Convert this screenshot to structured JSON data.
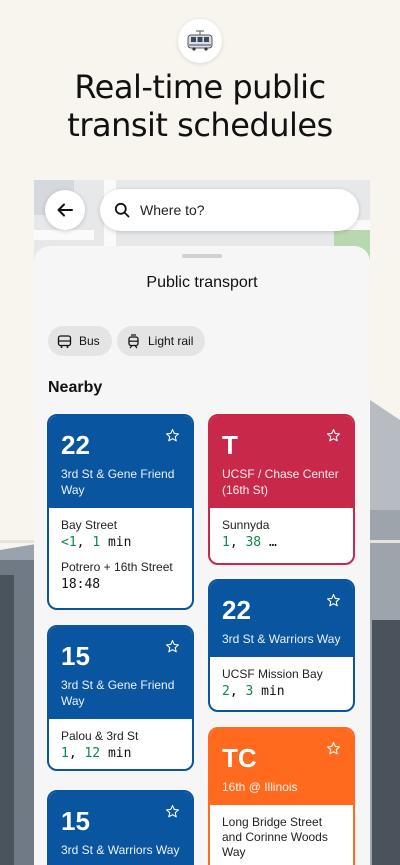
{
  "promo": {
    "headline_line1": "Real-time public",
    "headline_line2": "transit schedules",
    "icon": "tram-icon"
  },
  "search": {
    "placeholder": "Where to?"
  },
  "sheet": {
    "title": "Public transport",
    "filters": [
      {
        "label": "Bus",
        "icon": "bus-icon"
      },
      {
        "label": "Light rail",
        "icon": "light-rail-icon"
      }
    ],
    "section_title": "Nearby"
  },
  "cards": {
    "c1": {
      "route": "22",
      "stop": "3rd St & Gene Friend Way",
      "color": "#0a55a0",
      "arrivals": [
        {
          "dest": "Bay Street",
          "time_a": "<1",
          "sep": ", ",
          "time_b": "1",
          "unit": " min"
        },
        {
          "dest": "Potrero + 16th Street",
          "clock": "18:48"
        }
      ]
    },
    "c2": {
      "route": "15",
      "stop": "3rd St & Gene Friend Way",
      "color": "#0a55a0",
      "arrivals": [
        {
          "dest": "Palou & 3rd St",
          "time_a": "1",
          "sep": ", ",
          "time_b": "12",
          "unit": " min"
        }
      ]
    },
    "c3": {
      "route": "15",
      "stop": "3rd St & Warriors Way",
      "color": "#0a55a0"
    },
    "c4": {
      "route": "T",
      "stop": "UCSF / Chase Center (16th St)",
      "color": "#c8284a",
      "arrivals": [
        {
          "dest": "Sunnyda",
          "time_a": "1",
          "sep": ", ",
          "time_b": "38",
          "unit": " …"
        }
      ]
    },
    "c5": {
      "route": "22",
      "stop": "3rd St & Warriors Way",
      "color": "#0a55a0",
      "arrivals": [
        {
          "dest": "UCSF Mission Bay",
          "time_a": "2",
          "sep": ", ",
          "time_b": "3",
          "unit": " min"
        }
      ]
    },
    "c6": {
      "route": "TC",
      "stop": "16th @ Illinois",
      "color": "#ff6a1f",
      "arrivals": [
        {
          "dest": "Long Bridge Street and Corinne Woods Way"
        }
      ]
    }
  }
}
